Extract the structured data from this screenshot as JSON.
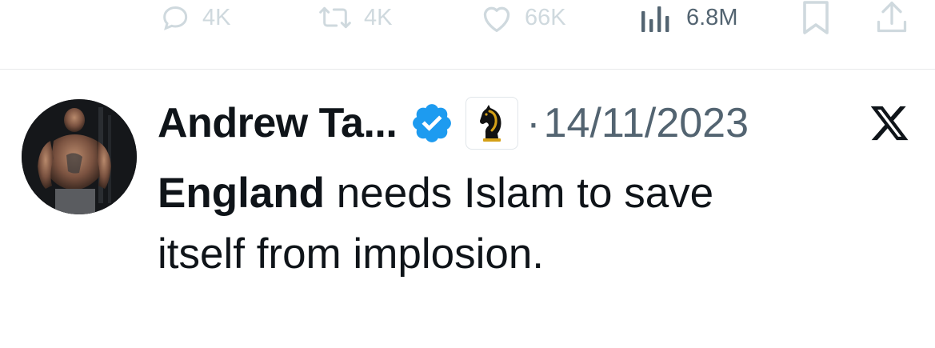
{
  "action_bar": {
    "reply": {
      "icon": "reply-icon",
      "count": "4K"
    },
    "retweet": {
      "icon": "retweet-icon",
      "count": "4K"
    },
    "like": {
      "icon": "heart-icon",
      "count": "66K"
    },
    "views": {
      "icon": "views-icon",
      "count": "6.8M"
    },
    "bookmark": {
      "icon": "bookmark-icon"
    },
    "share": {
      "icon": "share-icon"
    }
  },
  "tweet": {
    "author": {
      "display_name": "Andrew Ta...",
      "verified_icon": "verified-badge-icon",
      "affiliate_icon": "chess-knight-icon",
      "avatar_icon": "profile-photo"
    },
    "separator": "·",
    "date": "14/11/2023",
    "platform_icon": "x-logo-icon",
    "text": {
      "bold": "England",
      "rest_line1": " needs Islam to save",
      "rest_line2": "itself from implosion."
    }
  },
  "colors": {
    "text_primary": "#0f1419",
    "text_secondary": "#536471",
    "icon_muted": "#cfd9de",
    "verified_blue": "#1d9bf0",
    "divider": "#e7e9ea"
  }
}
